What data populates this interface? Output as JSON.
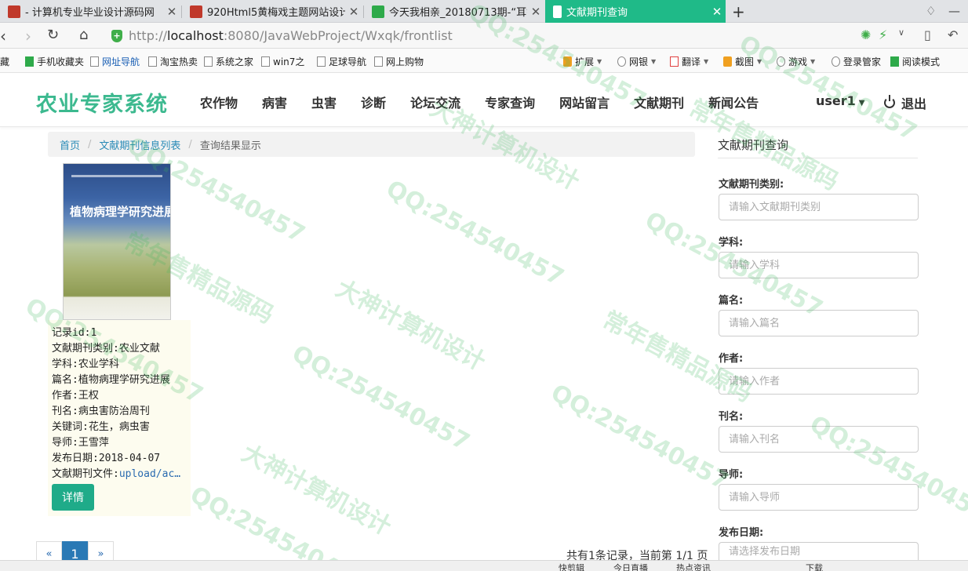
{
  "browser": {
    "tabs": [
      {
        "title": "- 计算机专业毕业设计源码网",
        "active": false
      },
      {
        "title": "920Html5黄梅戏主题网站设计",
        "active": false
      },
      {
        "title": "今天我相亲_20180713期-“耳钉",
        "active": false
      },
      {
        "title": "文献期刊查询",
        "active": true
      }
    ],
    "new_tab": "+",
    "url_prefix": "http://",
    "url_host": "localhost",
    "url_rest": ":8080/JavaWebProject/Wxqk/frontlist",
    "bookmarks": [
      "藏",
      "手机收藏夹",
      "网址导航",
      "淘宝热卖",
      "系统之家",
      "win7之",
      "足球导航",
      "网上购物",
      "扩展",
      "网银",
      "翻译",
      "截图",
      "游戏",
      "登录管家",
      "阅读模式"
    ]
  },
  "site": {
    "brand": "农业专家系统",
    "nav": [
      "农作物",
      "病害",
      "虫害",
      "诊断",
      "论坛交流",
      "专家查询",
      "网站留言",
      "文献期刊",
      "新闻公告"
    ],
    "user": "user1",
    "logout": "退出"
  },
  "breadcrumb": {
    "home": "首页",
    "list": "文献期刊信息列表",
    "current": "查询结果显示",
    "separator": "/"
  },
  "result": {
    "cover_title": "植物病理学研究进展",
    "fields": [
      "记录id:1",
      "文献期刊类别:农业文献",
      "学科:农业学科",
      "篇名:植物病理学研究进展",
      "作者:王权",
      "刊名:病虫害防治周刊",
      "关键词:花生，病虫害",
      "导师:王雪萍",
      "发布日期:2018-04-07"
    ],
    "file_label": "文献期刊文件:",
    "file_value": "upload/ac…",
    "detail_button": "详情"
  },
  "pager": {
    "prev": "«",
    "current": "1",
    "next": "»",
    "summary": "共有1条记录，当前第 1/1 页"
  },
  "search_panel": {
    "title": "文献期刊查询",
    "fields": [
      {
        "label": "文献期刊类别:",
        "placeholder": "请输入文献期刊类别"
      },
      {
        "label": "学科:",
        "placeholder": "请输入学科"
      },
      {
        "label": "篇名:",
        "placeholder": "请输入篇名"
      },
      {
        "label": "作者:",
        "placeholder": "请输入作者"
      },
      {
        "label": "刊名:",
        "placeholder": "请输入刊名"
      },
      {
        "label": "导师:",
        "placeholder": "请输入导师"
      },
      {
        "label": "发布日期:",
        "placeholder": "请选择发布日期"
      }
    ]
  },
  "statusbar": [
    "快剪辑",
    "今日直播",
    "热点资讯",
    "下载"
  ],
  "watermark": {
    "qq": "QQ:254540457",
    "text1": "大神计算机设计",
    "text2": "常年售精品源码"
  }
}
